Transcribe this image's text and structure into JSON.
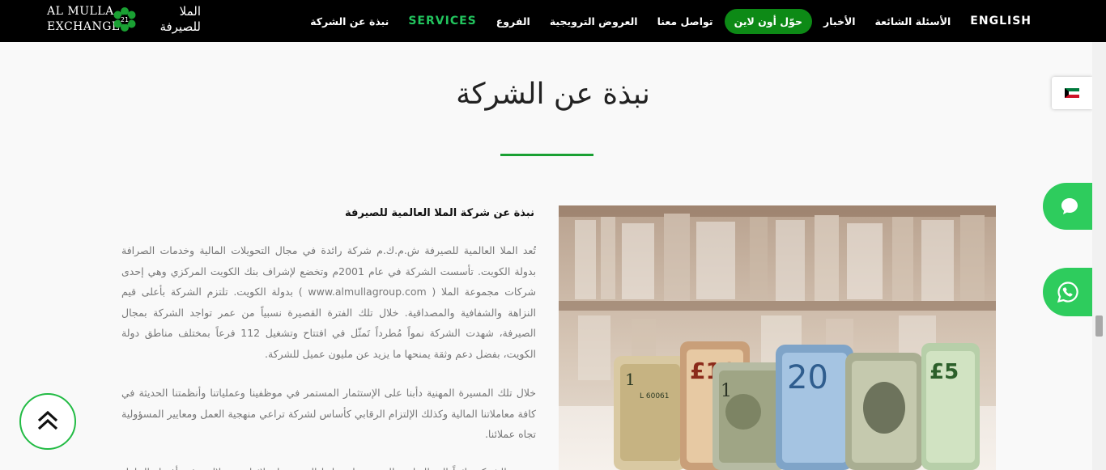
{
  "header": {
    "logo_en": "AL MULLA\nEXCHANGE",
    "logo_ar": "الملا\nللصيرفة",
    "nav": [
      {
        "label": "ENGLISH",
        "name": "nav-english"
      },
      {
        "label": "الأسئلة الشائعة",
        "name": "nav-faq"
      },
      {
        "label": "الأخبار",
        "name": "nav-news"
      },
      {
        "label": "حوّل أون لاين",
        "name": "nav-transfer-online"
      },
      {
        "label": "تواصل معنا",
        "name": "nav-contact"
      },
      {
        "label": "العروض الترويجية",
        "name": "nav-promotions"
      },
      {
        "label": "الفروع",
        "name": "nav-branches"
      },
      {
        "label": "SERVICES",
        "name": "nav-services"
      },
      {
        "label": "نبذة عن الشركة",
        "name": "nav-about"
      }
    ]
  },
  "page": {
    "title": "نبذة عن الشركة",
    "section_heading": "نبذة عن شركة الملا العالمية للصيرفة",
    "para1": "تُعد الملا العالمية للصيرفة ش.م.ك.م شركة رائدة في مجال التحويلات المالية وخدمات الصرافة بدولة الكويت. تأسست الشركة في عام 2001م وتخضع لإشراف بنك الكويت المركزي وهي إحدى شركات مجموعة الملا ( www.almullagroup.com ) بدولة الكويت. تلتزم الشركة بأعلى قيم النزاهة والشفافية والمصداقية. خلال تلك الفترة القصيرة نسبياً من عمر تواجد الشركة بمجال الصيرفة، شهدت الشركة نمواً مُطرداً تَمثّل في افتتاح وتشغيل 112 فرعاً بمختلف مناطق دولة الكويت، بفضل دعم وثقة يمنحها ما يزيد عن مليون عميل للشركة.",
    "para2": "خلال تلك المسيرة المهنية دأبنا على الإستثمار المستمر في موظفينا وعملياتنا وأنظمتنا الحديثة في كافة معاملاتنا المالية وكذلك الإلتزام الرقابي كأساس لشركة تراعي منهجية العمل ومعايير المسؤولية تجاه عملائنا.",
    "para3": "تسعى الشركة دائماً إلى التطوير المستمر لخدماتها المقدمة لعملائها من خلال توفير أفضل الحلول المالية."
  },
  "colors": {
    "accent": "#1aa033",
    "header_bg": "#000000",
    "floating_green": "#2ecc5d"
  },
  "icons": [
    "logo-emblem-icon",
    "kuwait-flag-icon",
    "chat-bubble-icon",
    "whatsapp-icon",
    "double-chevron-up-icon"
  ]
}
